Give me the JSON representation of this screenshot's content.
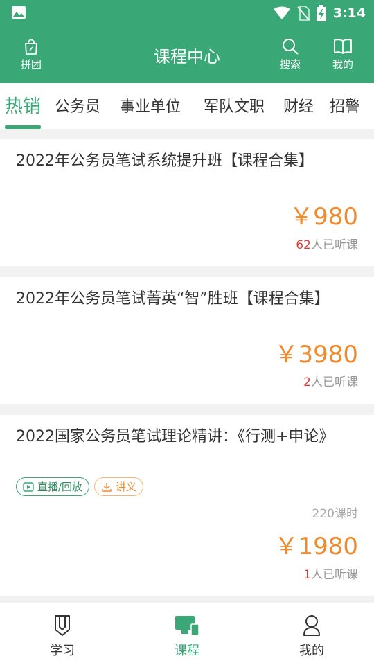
{
  "status_bar": {
    "time": "3:14"
  },
  "header": {
    "title": "课程中心",
    "group_buy_label": "拼团",
    "search_label": "搜索",
    "mine_label": "我的"
  },
  "tabs": [
    {
      "label": "热销",
      "active": true
    },
    {
      "label": "公务员"
    },
    {
      "label": "事业单位"
    },
    {
      "label": "军队文职"
    },
    {
      "label": "财经"
    },
    {
      "label": "招警"
    }
  ],
  "courses": [
    {
      "title": "2022年公务员笔试系统提升班【课程合集】",
      "price": "￥980",
      "listener_count": "62",
      "listener_suffix": "人已听课"
    },
    {
      "title": "2022年公务员笔试菁英“智”胜班【课程合集】",
      "price": "￥3980",
      "listener_count": "2",
      "listener_suffix": "人已听课"
    },
    {
      "title": "2022国家公务员笔试理论精讲：《行测+申论》",
      "tags": [
        "直播/回放",
        "讲义"
      ],
      "hours": "220课时",
      "price": "￥1980",
      "listener_count": "1",
      "listener_suffix": "人已听课"
    }
  ],
  "bottom_nav": [
    {
      "label": "学习",
      "icon": "pencil-bookmark-icon"
    },
    {
      "label": "课程",
      "icon": "monitor-icon",
      "active": true
    },
    {
      "label": "我的",
      "icon": "person-icon"
    }
  ],
  "colors": {
    "primary": "#3aa876",
    "price": "#f08a2c",
    "count": "#e53935"
  }
}
